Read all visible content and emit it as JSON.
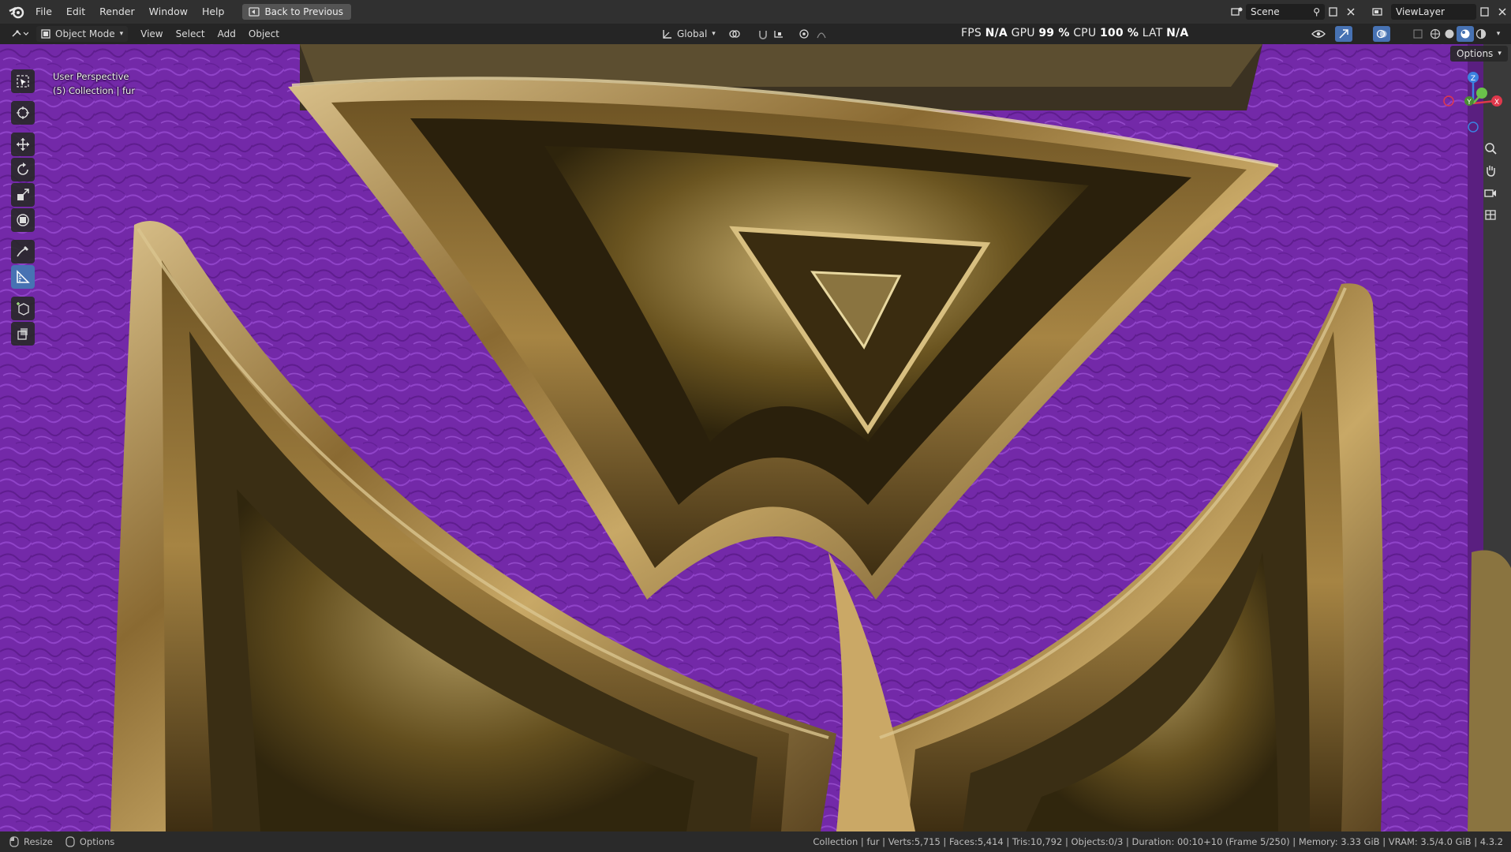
{
  "menubar": {
    "items": [
      "File",
      "Edit",
      "Render",
      "Window",
      "Help"
    ],
    "back_button": "Back to Previous",
    "scene_name": "Scene",
    "view_layer": "ViewLayer"
  },
  "header": {
    "mode": "Object Mode",
    "menus": [
      "View",
      "Select",
      "Add",
      "Object"
    ],
    "orientation": "Global"
  },
  "stats": {
    "fps_label": "FPS",
    "fps_value": "N/A",
    "gpu_label": "GPU",
    "gpu_value": "99 %",
    "cpu_label": "CPU",
    "cpu_value": "100 %",
    "lat_label": "LAT",
    "lat_value": "N/A"
  },
  "viewport": {
    "perspective": "User Perspective",
    "collection_info": "(5) Collection | fur",
    "options_label": "Options"
  },
  "statusbar": {
    "resize": "Resize",
    "options": "Options",
    "info": "Collection | fur | Verts:5,715 | Faces:5,414 | Tris:10,792 | Objects:0/3 | Duration: 00:10+10 (Frame 5/250) | Memory: 3.33 GiB | VRAM: 3.5/4.0 GiB | 4.3.2"
  },
  "colors": {
    "fur": "#7a2fb0",
    "gold": "#a8874a",
    "accent": "#4772b3"
  }
}
